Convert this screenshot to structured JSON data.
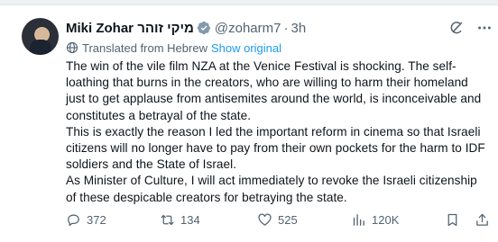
{
  "tweet": {
    "author_name": "Miki Zohar",
    "author_name_hebrew": "מיקי זוהר",
    "handle": "@zoharm7",
    "separator": "·",
    "time": "3h",
    "translated_label": "Translated from Hebrew",
    "show_original_label": "Show original",
    "paragraphs": [
      "The win of the vile film NZA at the Venice Festival is shocking. The self-loathing that burns in the creators, who are willing to harm their homeland just to get applause from antisemites around the world, is inconceivable and constitutes a betrayal of the state.",
      "This is exactly the reason I led the important reform in cinema so that Israeli citizens will no longer have to pay from their own pockets for the harm to IDF soldiers and the State of Israel.",
      "As Minister of Culture, I will act immediately to revoke the Israeli citizenship of these despicable creators for betraying the state."
    ]
  },
  "actions": {
    "replies": "372",
    "retweets": "134",
    "likes": "525",
    "views": "120K"
  },
  "colors": {
    "text": "#0f1419",
    "secondary": "#536471",
    "link": "#1d9bf0",
    "verified_badge": "#829aab"
  },
  "icons": [
    "verified-badge-icon",
    "grok-icon",
    "more-icon",
    "globe-icon",
    "reply-icon",
    "retweet-icon",
    "like-icon",
    "views-icon",
    "bookmark-icon",
    "share-icon"
  ]
}
